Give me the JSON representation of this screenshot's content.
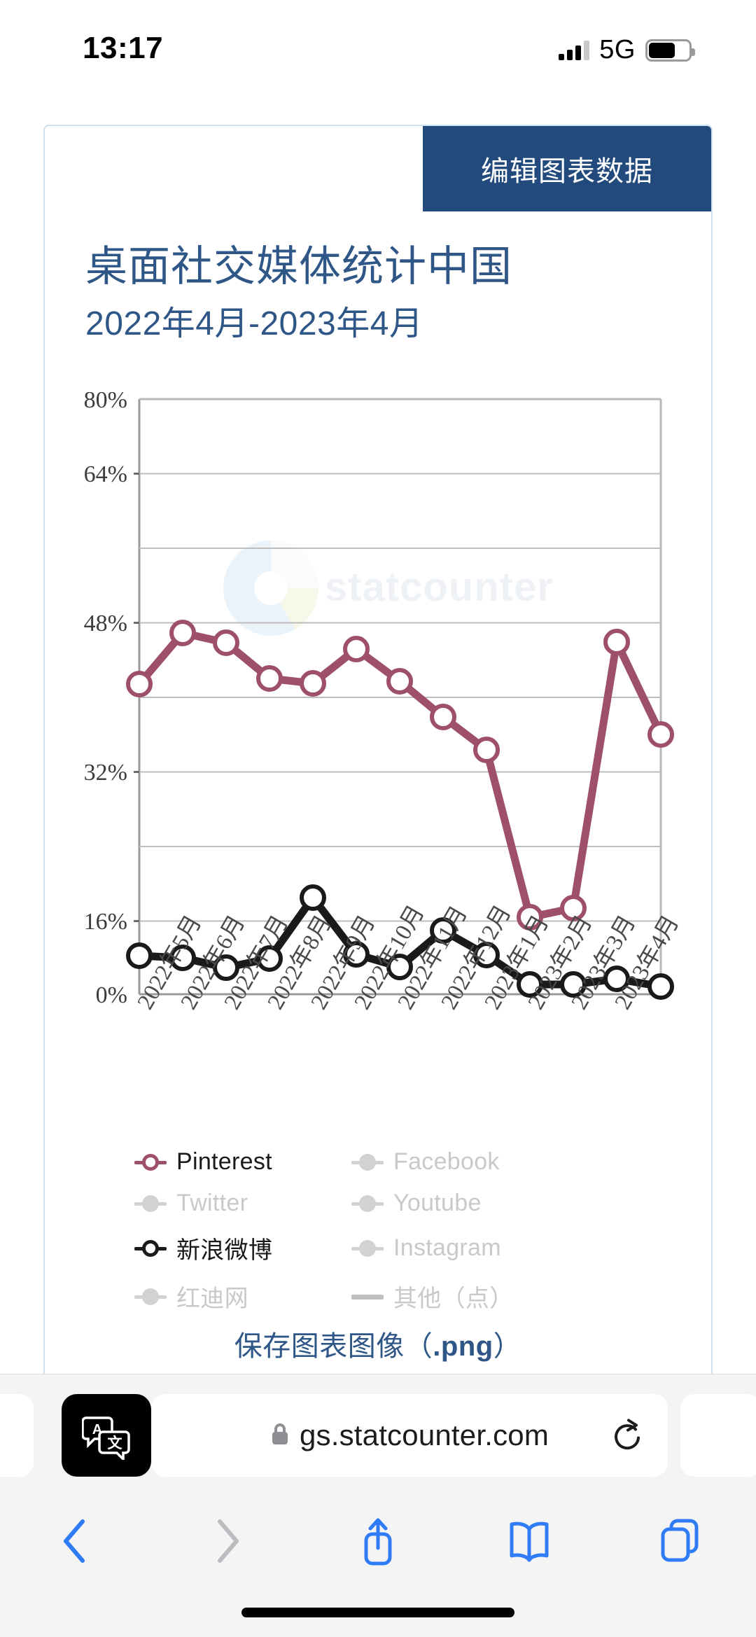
{
  "status_bar": {
    "time": "13:17",
    "network": "5G",
    "signal_icon": "cellular-bars-icon",
    "battery_icon": "battery-icon"
  },
  "page": {
    "edit_button_label": "编辑图表数据",
    "title": "桌面社交媒体统计中国",
    "subtitle": "2022年4月-2023年4月",
    "save_link_prefix": "保存图表图像（",
    "save_link_ext": ".png",
    "save_link_suffix": "）",
    "watermark": "statcounter"
  },
  "colors": {
    "accent_blue": "#2e5687",
    "edit_button_bg": "#234a7d",
    "pinterest": "#9d4f6c",
    "weibo": "#1a1a1a",
    "inactive": "#d2d2d2",
    "grid": "#b4b4b4",
    "axis": "#9a9a9a",
    "card_border": "#cfe0ef",
    "toolbar_blue": "#2f7cf6"
  },
  "chart_data": {
    "type": "line",
    "title": "桌面社交媒体统计中国",
    "subtitle": "2022年4月-2023年4月",
    "xlabel": "",
    "ylabel": "",
    "ylim": [
      0,
      80
    ],
    "yticks": [
      0,
      16,
      32,
      48,
      64,
      80
    ],
    "ytick_labels": [
      "0%",
      "16%",
      "32%",
      "48%",
      "64%",
      "80%"
    ],
    "grid": true,
    "legend_position": "below",
    "categories": [
      "2022年5月",
      "2022年6月",
      "2022年7月",
      "2022年8月",
      "2022年9月",
      "2022年10月",
      "2022年11月",
      "2022年12月",
      "2023年1月",
      "2023年2月",
      "2023年3月",
      "2023年4月"
    ],
    "series": [
      {
        "name": "Pinterest",
        "active": true,
        "color": "#9d4f6c",
        "values": [
          41.7,
          48.6,
          47.2,
          42.4,
          41.8,
          46.4,
          42.1,
          37.3,
          32.8,
          10.4,
          11.6,
          47.3
        ]
      },
      {
        "name": "新浪微博",
        "active": true,
        "color": "#1a1a1a",
        "values": [
          5.2,
          5.0,
          3.6,
          4.8,
          13.0,
          5.4,
          3.7,
          8.6,
          5.3,
          1.3,
          1.3,
          2.0
        ]
      }
    ],
    "extra_tail": {
      "note": "series extend one point past last category to chart right edge",
      "pinterest_last": 34.9,
      "weibo_last": 1.1
    },
    "legend": [
      {
        "label": "Pinterest",
        "active": true,
        "marker": "ring-line",
        "color": "#9d4f6c"
      },
      {
        "label": "Facebook",
        "active": false,
        "marker": "dot-line",
        "color": "#d2d2d2"
      },
      {
        "label": "Twitter",
        "active": false,
        "marker": "dot-line",
        "color": "#d2d2d2"
      },
      {
        "label": "Youtube",
        "active": false,
        "marker": "dot-line",
        "color": "#d2d2d2"
      },
      {
        "label": "新浪微博",
        "active": true,
        "marker": "ring-line",
        "color": "#1a1a1a"
      },
      {
        "label": "Instagram",
        "active": false,
        "marker": "dot-line",
        "color": "#d2d2d2"
      },
      {
        "label": "红迪网",
        "active": false,
        "marker": "dot-line",
        "color": "#d2d2d2"
      },
      {
        "label": "其他（点）",
        "active": false,
        "marker": "line",
        "color": "#c0c0c0"
      }
    ]
  },
  "browser": {
    "url": "gs.statcounter.com",
    "lock_icon": "lock-icon",
    "reload_icon": "reload-icon",
    "translate_icon": "translate-icon",
    "toolbar": [
      {
        "name": "back-button",
        "icon": "chevron-left-icon",
        "enabled": true
      },
      {
        "name": "forward-button",
        "icon": "chevron-right-icon",
        "enabled": false
      },
      {
        "name": "share-button",
        "icon": "share-icon",
        "enabled": true
      },
      {
        "name": "bookmarks-button",
        "icon": "book-icon",
        "enabled": true
      },
      {
        "name": "tabs-button",
        "icon": "tabs-icon",
        "enabled": true
      }
    ]
  }
}
